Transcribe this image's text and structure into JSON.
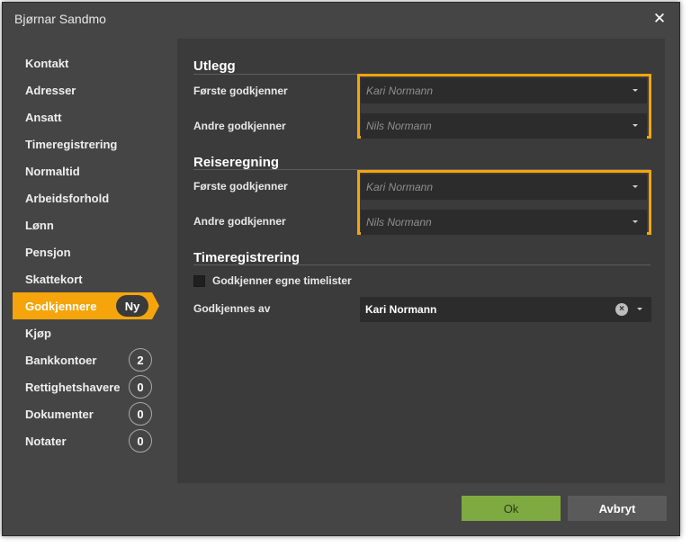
{
  "window": {
    "title": "Bjørnar Sandmo",
    "close_glyph": "✕"
  },
  "sidebar": {
    "items": [
      {
        "label": "Kontakt"
      },
      {
        "label": "Adresser"
      },
      {
        "label": "Ansatt"
      },
      {
        "label": "Timeregistrering"
      },
      {
        "label": "Normaltid"
      },
      {
        "label": "Arbeidsforhold"
      },
      {
        "label": "Lønn"
      },
      {
        "label": "Pensjon"
      },
      {
        "label": "Skattekort"
      },
      {
        "label": "Godkjennere",
        "badge": "Ny",
        "active": true
      },
      {
        "label": "Kjøp"
      },
      {
        "label": "Bankkontoer",
        "count": "2"
      },
      {
        "label": "Rettighetshavere",
        "count": "0"
      },
      {
        "label": "Dokumenter",
        "count": "0"
      },
      {
        "label": "Notater",
        "count": "0"
      }
    ]
  },
  "sections": {
    "utlegg": {
      "title": "Utlegg",
      "first_label": "Første godkjenner",
      "first_placeholder": "Kari Normann",
      "second_label": "Andre godkjenner",
      "second_placeholder": "Nils Normann"
    },
    "reiseregning": {
      "title": "Reiseregning",
      "first_label": "Første godkjenner",
      "first_placeholder": "Kari Normann",
      "second_label": "Andre godkjenner",
      "second_placeholder": "Nils Normann"
    },
    "timeregistrering": {
      "title": "Timeregistrering",
      "checkbox_label": "Godkjenner egne timelister",
      "approved_by_label": "Godkjennes av",
      "approved_by_value": "Kari Normann",
      "clear_glyph": "×"
    }
  },
  "footer": {
    "ok_label": "Ok",
    "cancel_label": "Avbryt"
  },
  "colors": {
    "accent": "#f5a50b",
    "ok_button": "#7faa42",
    "dialog_bg": "#454545",
    "content_bg": "#3b3b3b"
  }
}
